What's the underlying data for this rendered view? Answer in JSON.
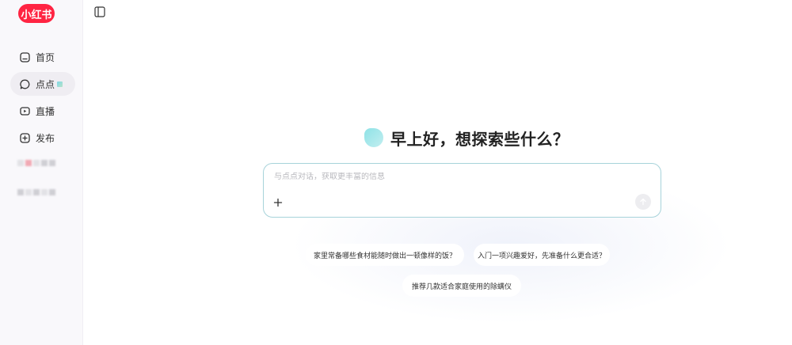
{
  "sidebar": {
    "logo_text": "小红书",
    "items": [
      {
        "label": "首页",
        "icon": "home-icon",
        "active": false
      },
      {
        "label": "点点",
        "icon": "chat-bubble-icon",
        "active": true
      },
      {
        "label": "直播",
        "icon": "live-icon",
        "active": false
      },
      {
        "label": "发布",
        "icon": "plus-square-icon",
        "active": false
      }
    ]
  },
  "main": {
    "greeting": "早上好，想探索些什么？",
    "input": {
      "placeholder": "与点点对话，获取更丰富的信息",
      "value": ""
    },
    "suggestions": [
      "家里常备哪些食材能随时做出一顿像样的饭？",
      "入门一项兴趣爱好，先准备什么更合适？",
      "推荐几款适合家庭使用的除螨仪"
    ]
  },
  "colors": {
    "brand": "#ff2442",
    "input_border": "#a7d3da",
    "sidebar_bg": "#f9f8fb"
  }
}
